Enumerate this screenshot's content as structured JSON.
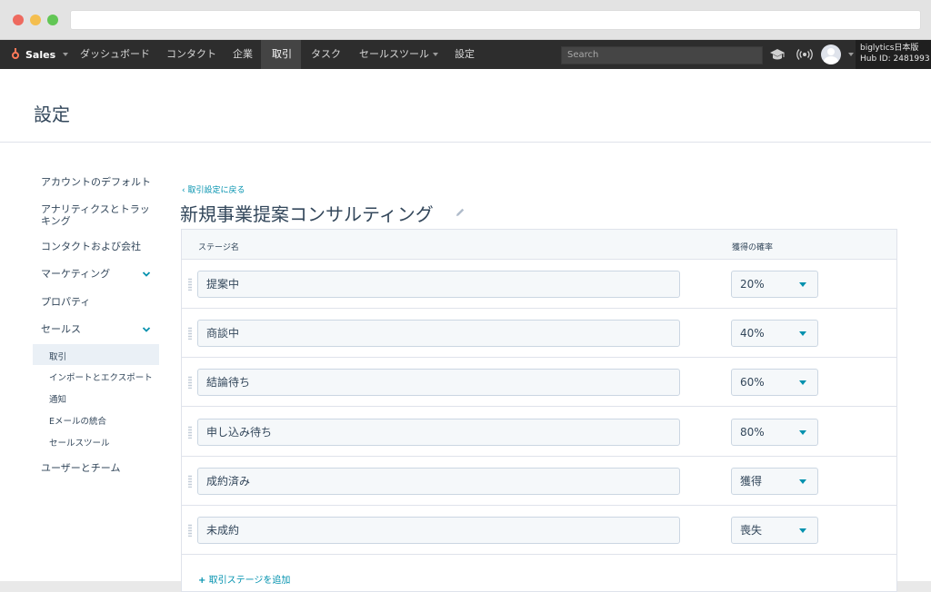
{
  "topnav": {
    "brand": "Sales",
    "items": [
      {
        "label": "ダッシュボード",
        "active": false
      },
      {
        "label": "コンタクト",
        "active": false
      },
      {
        "label": "企業",
        "active": false
      },
      {
        "label": "取引",
        "active": true
      },
      {
        "label": "タスク",
        "active": false
      },
      {
        "label": "セールスツール",
        "active": false
      },
      {
        "label": "設定",
        "active": false
      }
    ],
    "search_placeholder": "Search",
    "account_name": "biglytics日本版",
    "hub_id": "Hub ID: 2481993"
  },
  "page": {
    "title": "設定"
  },
  "sidebar": {
    "items": [
      {
        "label": "アカウントのデフォルト"
      },
      {
        "label": "アナリティクスとトラッキング"
      },
      {
        "label": "コンタクトおよび会社"
      },
      {
        "label": "マーケティング"
      },
      {
        "label": "プロパティ"
      },
      {
        "label": "セールス"
      },
      {
        "label": "ユーザーとチーム"
      }
    ],
    "subitems": [
      {
        "label": "取引",
        "active": true
      },
      {
        "label": "インポートとエクスポート",
        "active": false
      },
      {
        "label": "通知",
        "active": false
      },
      {
        "label": "Eメールの統合",
        "active": false
      },
      {
        "label": "セールスツール",
        "active": false
      }
    ]
  },
  "content": {
    "back_link": "取引設定に戻る",
    "pipeline_title": "新規事業提案コンサルティング",
    "table": {
      "col_stage": "ステージ名",
      "col_probability": "獲得の確率",
      "rows": [
        {
          "stage": "提案中",
          "probability": "20%"
        },
        {
          "stage": "商談中",
          "probability": "40%"
        },
        {
          "stage": "結論待ち",
          "probability": "60%"
        },
        {
          "stage": "申し込み待ち",
          "probability": "80%"
        },
        {
          "stage": "成約済み",
          "probability": "獲得"
        },
        {
          "stage": "未成約",
          "probability": "喪失"
        }
      ]
    },
    "add_stage": "取引ステージを追加"
  },
  "colors": {
    "accent": "#0091ae",
    "brand": "#ff7a59",
    "nav_bg": "#2d2d2d"
  }
}
